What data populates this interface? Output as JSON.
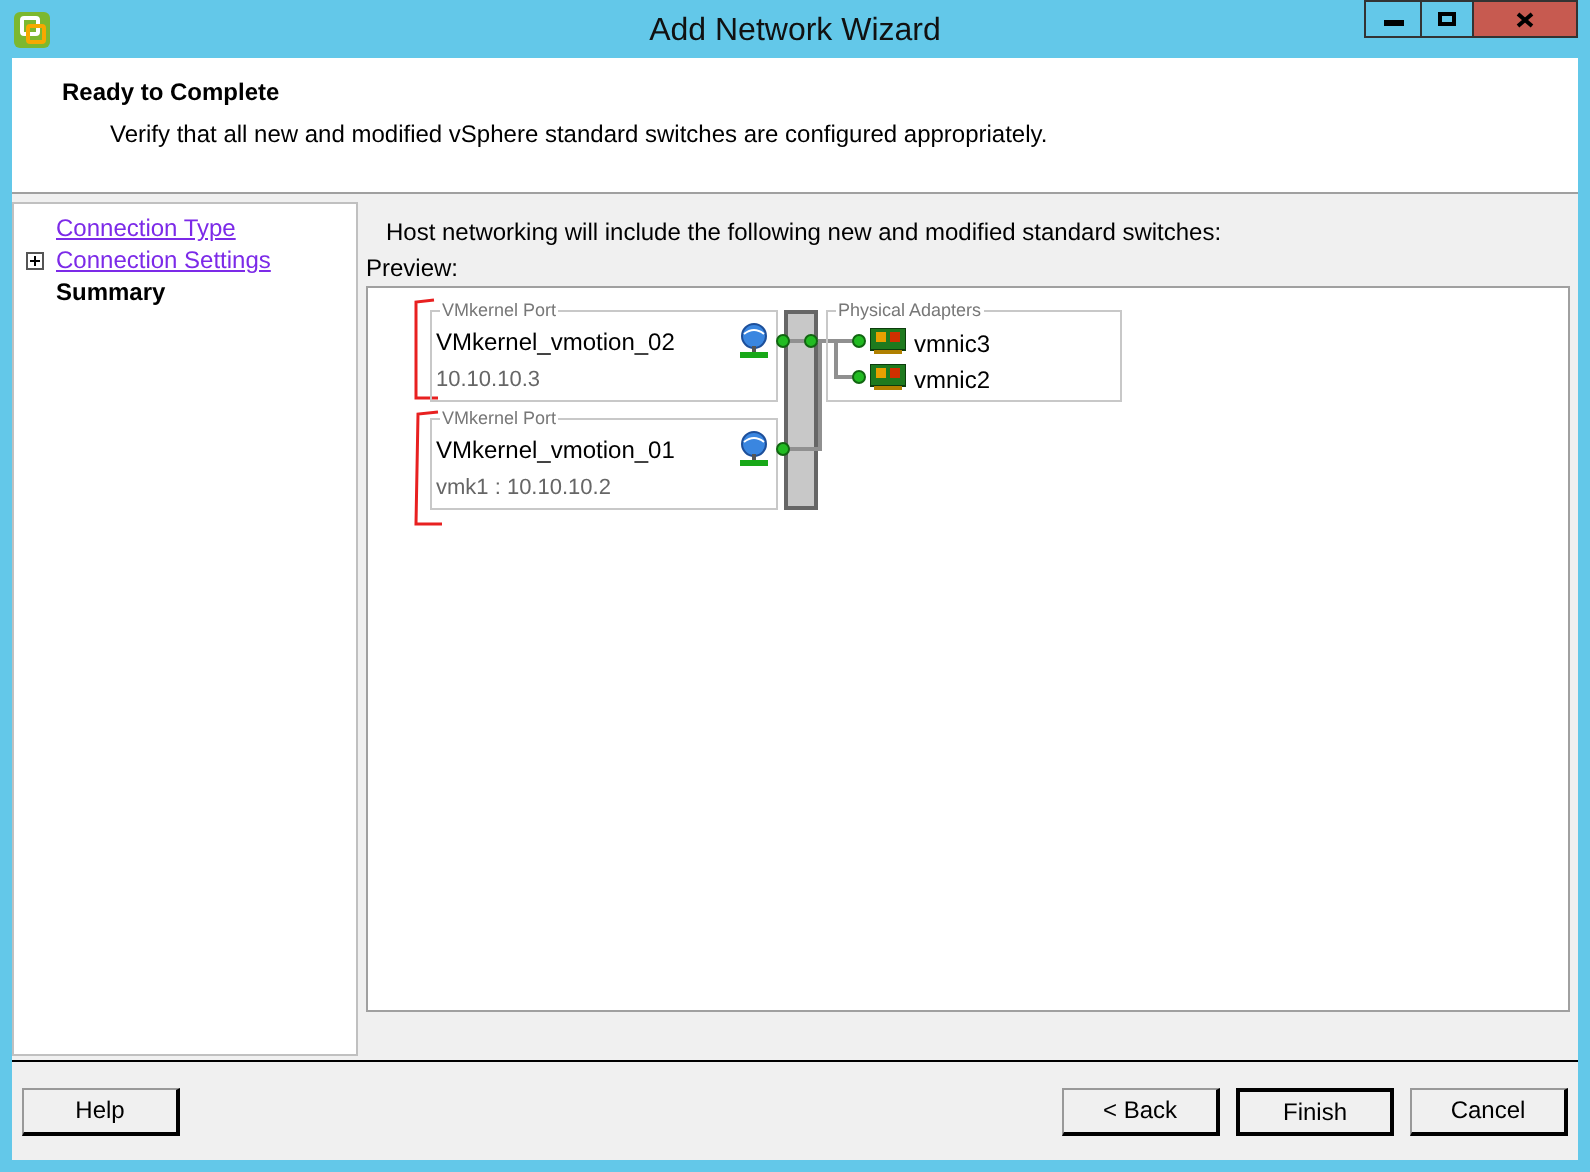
{
  "window": {
    "title": "Add Network Wizard"
  },
  "header": {
    "title": "Ready to Complete",
    "subtitle": "Verify that all new and modified vSphere standard switches are configured appropriately."
  },
  "steps": [
    {
      "label": "Connection Type",
      "selected": false,
      "expandable": false
    },
    {
      "label": "Connection Settings",
      "selected": false,
      "expandable": true,
      "expanded": false
    },
    {
      "label": "Summary",
      "selected": true,
      "expandable": false
    }
  ],
  "intro": "Host networking will include the following new and modified standard switches:",
  "preview_label": "Preview:",
  "ports": [
    {
      "group_label": "VMkernel Port",
      "name": "VMkernel_vmotion_02",
      "detail": "10.10.10.3"
    },
    {
      "group_label": "VMkernel Port",
      "name": "VMkernel_vmotion_01",
      "detail": "vmk1 : 10.10.10.2"
    }
  ],
  "adapters": {
    "group_label": "Physical Adapters",
    "items": [
      "vmnic3",
      "vmnic2"
    ]
  },
  "buttons": [
    {
      "label": "Help",
      "default": false
    },
    {
      "label": "< Back",
      "default": false
    },
    {
      "label": "Finish",
      "default": true
    },
    {
      "label": "Cancel",
      "default": false
    }
  ]
}
